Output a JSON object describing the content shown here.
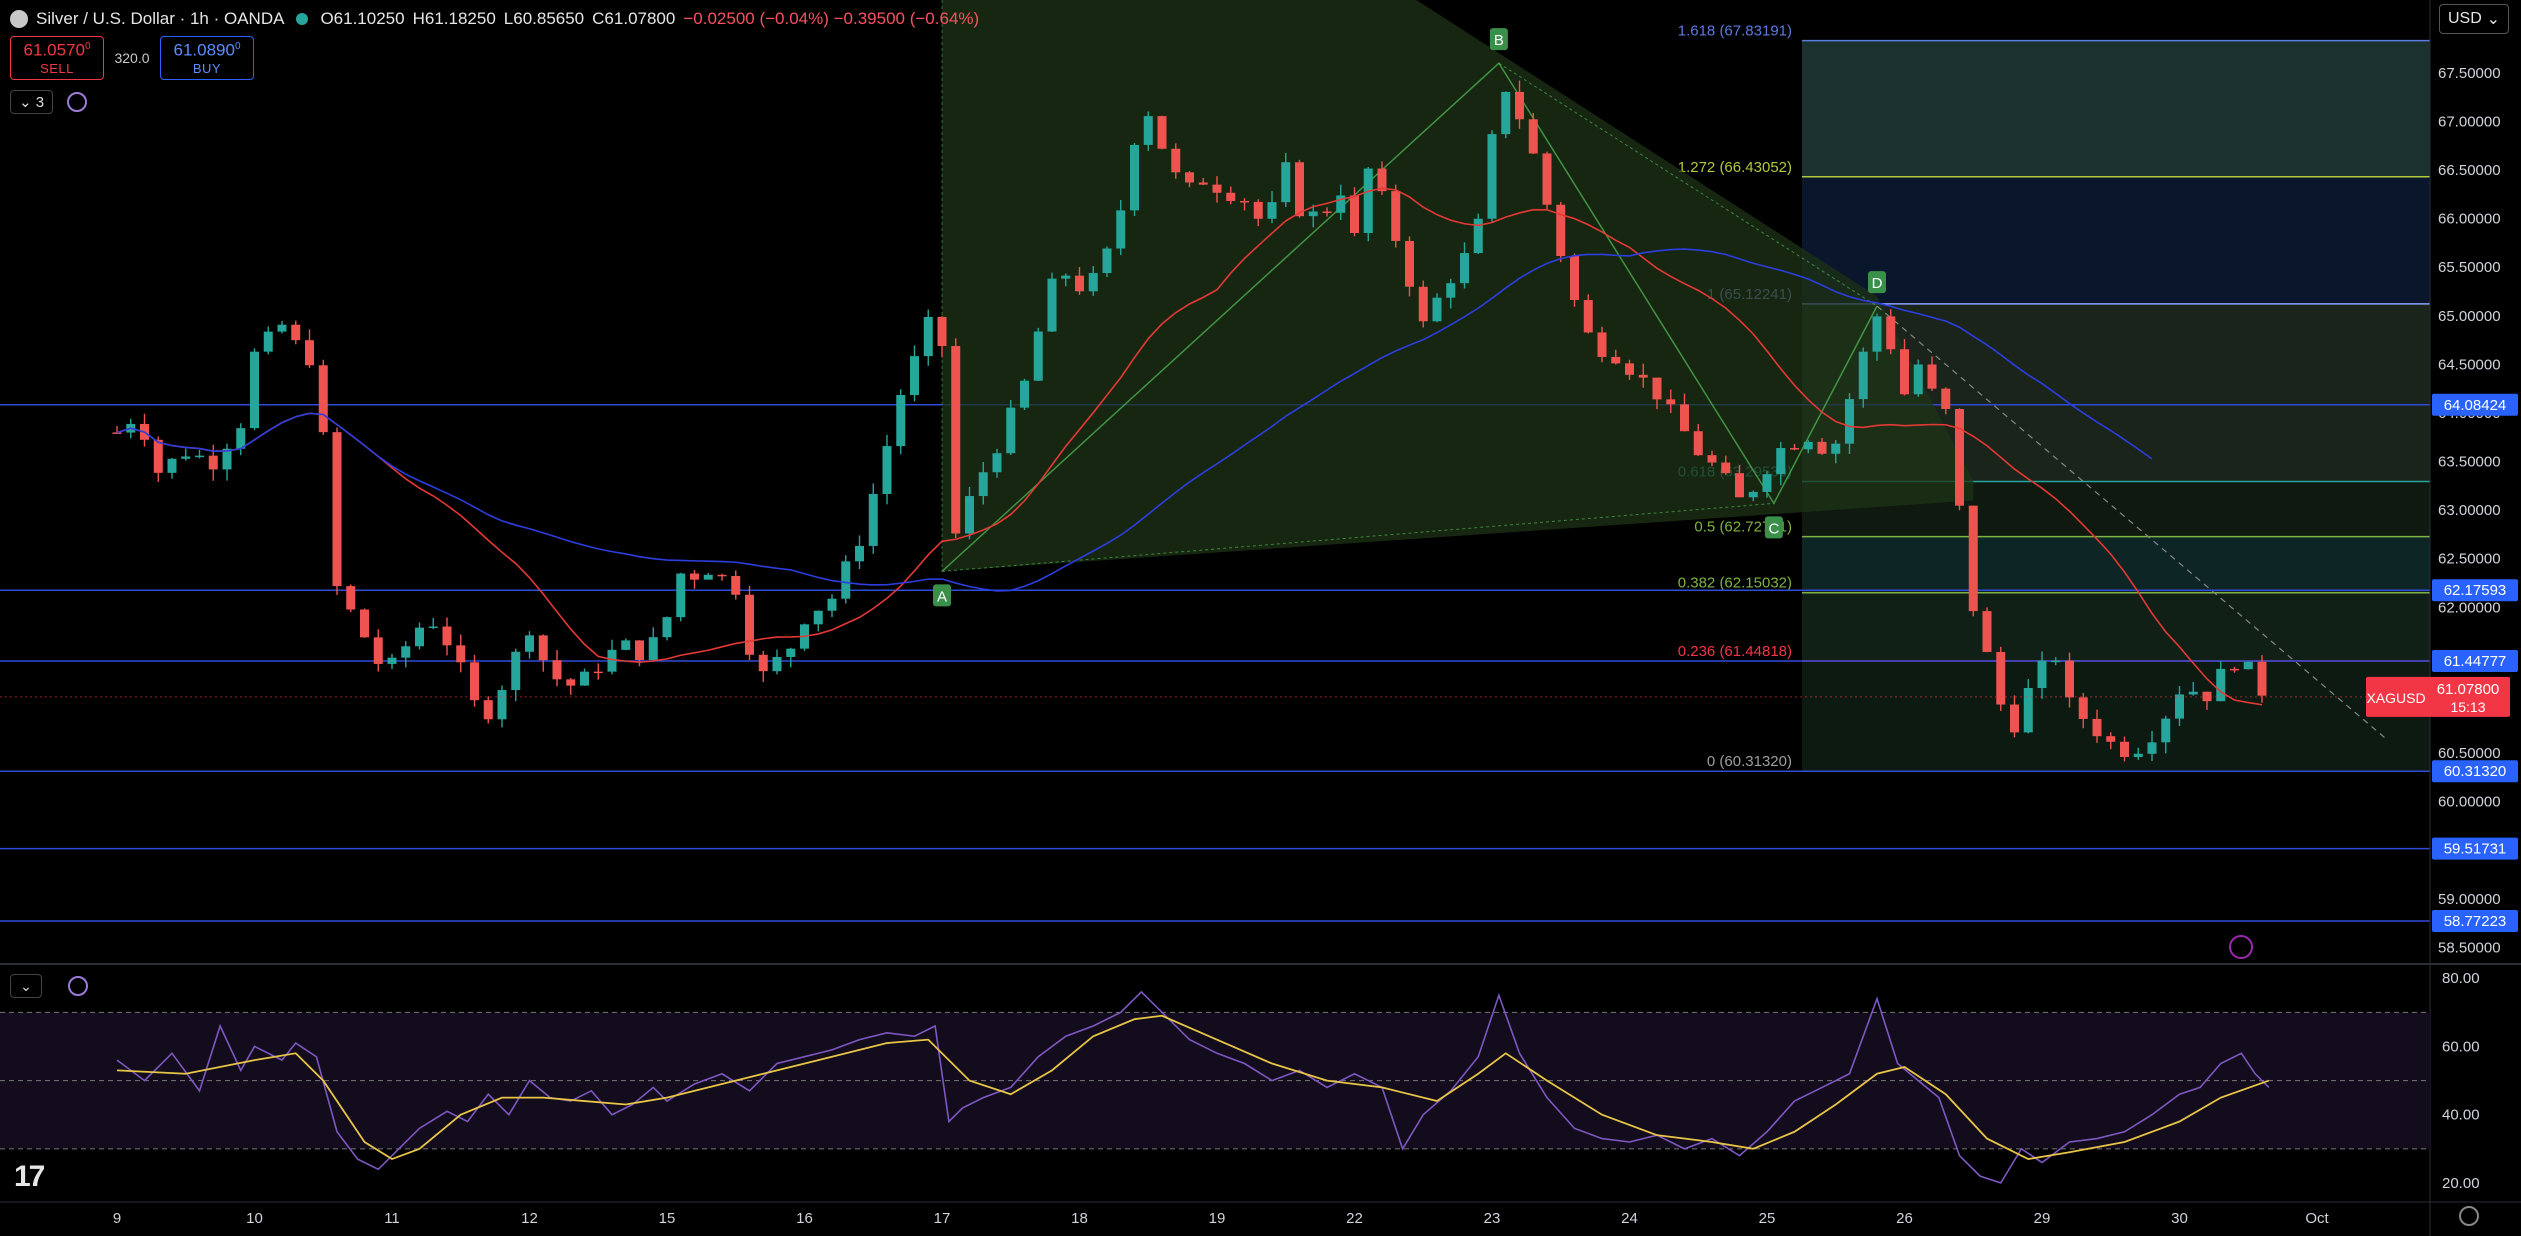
{
  "header": {
    "symbol": "Silver / U.S. Dollar · 1h · OANDA",
    "open": "O61.10250",
    "high": "H61.18250",
    "low": "L60.85650",
    "close": "C61.07800",
    "change": "−0.02500 (−0.04%)  −0.39500 (−0.64%)"
  },
  "trade": {
    "sell_price": "61.0570",
    "sell_sup": "0",
    "sell_label": "SELL",
    "spread": "320.0",
    "buy_price": "61.0890",
    "buy_sup": "0",
    "buy_label": "BUY"
  },
  "indicators_toggle": {
    "count": "3"
  },
  "currency": "USD",
  "colors": {
    "up": "#26a69a",
    "down": "#ef5350",
    "ma_fast": "#e53935",
    "ma_slow": "#2c3ee0",
    "rsi_line": "#7e57c2",
    "rsi_ma": "#e8c547",
    "hline": "#2f4bd8",
    "pattern_fill": "#1d3317"
  },
  "chart_data": {
    "type": "candlestick",
    "symbol": "XAGUSD",
    "y_ticks": [
      "67.50000",
      "67.00000",
      "66.50000",
      "66.00000",
      "65.50000",
      "65.00000",
      "64.50000",
      "64.00000",
      "63.50000",
      "63.00000",
      "62.50000",
      "62.00000",
      "61.50000",
      "61.00000",
      "60.50000",
      "60.00000",
      "59.50000",
      "59.00000",
      "58.50000"
    ],
    "ylim": [
      58.35,
      68.25
    ],
    "x_labels": [
      "9",
      "10",
      "11",
      "12",
      "15",
      "16",
      "17",
      "18",
      "19",
      "22",
      "23",
      "24",
      "25",
      "26",
      "29",
      "30",
      "Oct"
    ],
    "x_label_index": [
      0,
      1,
      2,
      3,
      4,
      5,
      6,
      7,
      8,
      9,
      10,
      11,
      12,
      13,
      14,
      15,
      16
    ],
    "price_levels": [
      {
        "value": 64.08424,
        "label": "64.08424",
        "color": "#2962ff"
      },
      {
        "value": 62.17593,
        "label": "62.17593",
        "color": "#2962ff"
      },
      {
        "value": 61.44777,
        "label": "61.44777",
        "color": "#2962ff"
      },
      {
        "value": 60.3132,
        "label": "60.31320",
        "color": "#2962ff"
      },
      {
        "value": 59.51731,
        "label": "59.51731",
        "color": "#2962ff"
      },
      {
        "value": 58.77223,
        "label": "58.77223",
        "color": "#2962ff"
      }
    ],
    "last_price": {
      "label": "XAGUSD",
      "value": 61.078,
      "value_label": "61.07800",
      "countdown": "15:13",
      "color": "#f23645"
    },
    "fibonacci": [
      {
        "ratio": "1.618",
        "value": 67.83191,
        "label": "1.618 (67.83191)",
        "color": "#5c7be0"
      },
      {
        "ratio": "1.272",
        "value": 66.43052,
        "label": "1.272 (66.43052)",
        "color": "#b2c93a"
      },
      {
        "ratio": "1",
        "value": 65.12241,
        "label": "1 (65.12241)",
        "color": "#8aa0ff"
      },
      {
        "ratio": "0.618",
        "value": 63.2953,
        "label": "0.618 (63.29530)",
        "color": "#26a69a"
      },
      {
        "ratio": "0.5",
        "value": 62.72781,
        "label": "0.5 (62.72781)",
        "color": "#7fb341"
      },
      {
        "ratio": "0.382",
        "value": 62.15032,
        "label": "0.382 (62.15032)",
        "color": "#7fb341"
      },
      {
        "ratio": "0.236",
        "value": 61.44818,
        "label": "0.236 (61.44818)",
        "color": "#f23645"
      },
      {
        "ratio": "0",
        "value": 60.3132,
        "label": "0 (60.31320)",
        "color": "#9e9e9e"
      }
    ],
    "pattern_points": [
      {
        "label": "A",
        "day": 6.0,
        "value": 62.37
      },
      {
        "label": "B",
        "day": 10.05,
        "value": 67.6
      },
      {
        "label": "C",
        "day": 12.05,
        "value": 63.07
      },
      {
        "label": "D",
        "day": 12.8,
        "value": 65.1
      }
    ],
    "price_path": [
      [
        0.0,
        63.8
      ],
      [
        0.15,
        64.0
      ],
      [
        0.3,
        63.4
      ],
      [
        0.5,
        63.6
      ],
      [
        0.7,
        63.5
      ],
      [
        0.9,
        63.9
      ],
      [
        1.0,
        64.6
      ],
      [
        1.2,
        64.9
      ],
      [
        1.3,
        64.7
      ],
      [
        1.45,
        64.5
      ],
      [
        1.6,
        62.2
      ],
      [
        1.8,
        61.7
      ],
      [
        1.95,
        61.3
      ],
      [
        2.05,
        61.5
      ],
      [
        2.25,
        61.9
      ],
      [
        2.35,
        61.8
      ],
      [
        2.45,
        61.5
      ],
      [
        2.55,
        61.2
      ],
      [
        2.65,
        60.8
      ],
      [
        2.8,
        61.2
      ],
      [
        2.9,
        61.5
      ],
      [
        3.0,
        61.8
      ],
      [
        3.15,
        61.3
      ],
      [
        3.3,
        61.2
      ],
      [
        3.45,
        61.3
      ],
      [
        3.55,
        61.5
      ],
      [
        3.7,
        61.6
      ],
      [
        3.85,
        61.5
      ],
      [
        4.0,
        61.9
      ],
      [
        4.05,
        62.4
      ],
      [
        4.15,
        62.3
      ],
      [
        4.3,
        62.4
      ],
      [
        4.5,
        62.2
      ],
      [
        4.6,
        61.6
      ],
      [
        4.7,
        61.3
      ],
      [
        4.9,
        61.6
      ],
      [
        5.0,
        61.9
      ],
      [
        5.2,
        62.1
      ],
      [
        5.4,
        62.7
      ],
      [
        5.55,
        63.4
      ],
      [
        5.7,
        64.2
      ],
      [
        5.85,
        64.7
      ],
      [
        5.95,
        65.1
      ],
      [
        6.0,
        64.7
      ],
      [
        6.05,
        63.0
      ],
      [
        6.1,
        62.75
      ],
      [
        6.2,
        63.1
      ],
      [
        6.3,
        63.4
      ],
      [
        6.45,
        63.8
      ],
      [
        6.6,
        64.3
      ],
      [
        6.75,
        65.1
      ],
      [
        6.85,
        65.5
      ],
      [
        7.0,
        65.3
      ],
      [
        7.15,
        65.4
      ],
      [
        7.3,
        66.1
      ],
      [
        7.45,
        67.2
      ],
      [
        7.55,
        67.0
      ],
      [
        7.65,
        66.5
      ],
      [
        7.8,
        66.3
      ],
      [
        7.9,
        66.4
      ],
      [
        8.05,
        66.3
      ],
      [
        8.2,
        66.2
      ],
      [
        8.35,
        65.9
      ],
      [
        8.5,
        66.5
      ],
      [
        8.6,
        66.1
      ],
      [
        8.75,
        66.0
      ],
      [
        8.9,
        66.3
      ],
      [
        9.0,
        65.8
      ],
      [
        9.1,
        66.5
      ],
      [
        9.2,
        66.2
      ],
      [
        9.35,
        65.6
      ],
      [
        9.5,
        64.9
      ],
      [
        9.65,
        65.3
      ],
      [
        9.8,
        65.6
      ],
      [
        9.95,
        66.1
      ],
      [
        10.05,
        67.5
      ],
      [
        10.15,
        67.2
      ],
      [
        10.25,
        66.9
      ],
      [
        10.35,
        66.4
      ],
      [
        10.45,
        65.9
      ],
      [
        10.55,
        65.4
      ],
      [
        10.65,
        64.9
      ],
      [
        10.75,
        64.7
      ],
      [
        10.9,
        64.6
      ],
      [
        11.05,
        64.4
      ],
      [
        11.2,
        64.2
      ],
      [
        11.35,
        63.9
      ],
      [
        11.5,
        63.6
      ],
      [
        11.65,
        63.4
      ],
      [
        11.8,
        63.1
      ],
      [
        11.95,
        63.3
      ],
      [
        12.05,
        63.6
      ],
      [
        12.2,
        63.7
      ],
      [
        12.35,
        63.8
      ],
      [
        12.45,
        63.5
      ],
      [
        12.55,
        63.9
      ],
      [
        12.65,
        64.4
      ],
      [
        12.8,
        65.0
      ],
      [
        12.9,
        64.7
      ],
      [
        13.0,
        64.2
      ],
      [
        13.1,
        64.5
      ],
      [
        13.2,
        64.2
      ],
      [
        13.3,
        64.0
      ],
      [
        13.4,
        63.0
      ],
      [
        13.5,
        62.0
      ],
      [
        13.6,
        61.5
      ],
      [
        13.7,
        61.0
      ],
      [
        13.8,
        60.8
      ],
      [
        13.95,
        61.3
      ],
      [
        14.1,
        61.5
      ],
      [
        14.2,
        61.0
      ],
      [
        14.35,
        60.8
      ],
      [
        14.5,
        60.6
      ],
      [
        14.65,
        60.5
      ],
      [
        14.8,
        60.7
      ],
      [
        14.95,
        61.0
      ],
      [
        15.05,
        61.3
      ],
      [
        15.15,
        61.0
      ],
      [
        15.25,
        61.2
      ],
      [
        15.35,
        61.4
      ],
      [
        15.45,
        61.5
      ],
      [
        15.55,
        61.2
      ],
      [
        15.65,
        61.08
      ]
    ],
    "rsi": {
      "y_ticks": [
        "80.00",
        "60.00",
        "40.00",
        "20.00"
      ],
      "ylim": [
        15,
        83
      ],
      "levels": [
        70,
        50,
        30
      ],
      "path": [
        [
          0.0,
          56
        ],
        [
          0.2,
          50
        ],
        [
          0.4,
          58
        ],
        [
          0.6,
          47
        ],
        [
          0.75,
          66
        ],
        [
          0.9,
          53
        ],
        [
          1.0,
          60
        ],
        [
          1.2,
          56
        ],
        [
          1.3,
          61
        ],
        [
          1.45,
          57
        ],
        [
          1.6,
          35
        ],
        [
          1.75,
          27
        ],
        [
          1.9,
          24
        ],
        [
          2.05,
          30
        ],
        [
          2.2,
          36
        ],
        [
          2.4,
          41
        ],
        [
          2.55,
          38
        ],
        [
          2.7,
          46
        ],
        [
          2.85,
          40
        ],
        [
          3.0,
          50
        ],
        [
          3.15,
          45
        ],
        [
          3.3,
          44
        ],
        [
          3.45,
          47
        ],
        [
          3.6,
          40
        ],
        [
          3.75,
          43
        ],
        [
          3.9,
          48
        ],
        [
          4.0,
          44
        ],
        [
          4.2,
          49
        ],
        [
          4.4,
          52
        ],
        [
          4.6,
          47
        ],
        [
          4.8,
          55
        ],
        [
          5.0,
          57
        ],
        [
          5.2,
          59
        ],
        [
          5.4,
          62
        ],
        [
          5.6,
          64
        ],
        [
          5.8,
          63
        ],
        [
          5.95,
          66
        ],
        [
          6.05,
          38
        ],
        [
          6.15,
          42
        ],
        [
          6.3,
          45
        ],
        [
          6.5,
          48
        ],
        [
          6.7,
          57
        ],
        [
          6.9,
          63
        ],
        [
          7.1,
          66
        ],
        [
          7.3,
          70
        ],
        [
          7.45,
          76
        ],
        [
          7.6,
          70
        ],
        [
          7.8,
          62
        ],
        [
          8.0,
          58
        ],
        [
          8.2,
          55
        ],
        [
          8.4,
          50
        ],
        [
          8.6,
          53
        ],
        [
          8.8,
          48
        ],
        [
          9.0,
          52
        ],
        [
          9.2,
          48
        ],
        [
          9.35,
          30
        ],
        [
          9.5,
          40
        ],
        [
          9.7,
          47
        ],
        [
          9.9,
          57
        ],
        [
          10.05,
          75
        ],
        [
          10.2,
          58
        ],
        [
          10.4,
          45
        ],
        [
          10.6,
          36
        ],
        [
          10.8,
          33
        ],
        [
          11.0,
          32
        ],
        [
          11.2,
          34
        ],
        [
          11.4,
          30
        ],
        [
          11.6,
          33
        ],
        [
          11.8,
          28
        ],
        [
          12.0,
          35
        ],
        [
          12.2,
          44
        ],
        [
          12.4,
          48
        ],
        [
          12.6,
          52
        ],
        [
          12.8,
          74
        ],
        [
          12.95,
          55
        ],
        [
          13.1,
          50
        ],
        [
          13.25,
          45
        ],
        [
          13.4,
          28
        ],
        [
          13.55,
          22
        ],
        [
          13.7,
          20
        ],
        [
          13.85,
          30
        ],
        [
          14.0,
          26
        ],
        [
          14.2,
          32
        ],
        [
          14.4,
          33
        ],
        [
          14.6,
          35
        ],
        [
          14.8,
          40
        ],
        [
          15.0,
          46
        ],
        [
          15.15,
          48
        ],
        [
          15.3,
          55
        ],
        [
          15.45,
          58
        ],
        [
          15.55,
          52
        ],
        [
          15.65,
          48
        ]
      ],
      "ma_path": [
        [
          0.0,
          53
        ],
        [
          0.5,
          52
        ],
        [
          1.0,
          56
        ],
        [
          1.3,
          58
        ],
        [
          1.5,
          50
        ],
        [
          1.8,
          32
        ],
        [
          2.0,
          27
        ],
        [
          2.2,
          30
        ],
        [
          2.5,
          40
        ],
        [
          2.8,
          45
        ],
        [
          3.1,
          45
        ],
        [
          3.4,
          44
        ],
        [
          3.7,
          43
        ],
        [
          4.0,
          45
        ],
        [
          4.4,
          49
        ],
        [
          4.8,
          53
        ],
        [
          5.2,
          57
        ],
        [
          5.6,
          61
        ],
        [
          5.9,
          62
        ],
        [
          6.2,
          50
        ],
        [
          6.5,
          46
        ],
        [
          6.8,
          53
        ],
        [
          7.1,
          63
        ],
        [
          7.4,
          68
        ],
        [
          7.6,
          69
        ],
        [
          8.0,
          62
        ],
        [
          8.4,
          55
        ],
        [
          8.8,
          50
        ],
        [
          9.2,
          48
        ],
        [
          9.6,
          44
        ],
        [
          9.9,
          52
        ],
        [
          10.1,
          58
        ],
        [
          10.4,
          50
        ],
        [
          10.8,
          40
        ],
        [
          11.2,
          34
        ],
        [
          11.6,
          32
        ],
        [
          11.9,
          30
        ],
        [
          12.2,
          35
        ],
        [
          12.5,
          43
        ],
        [
          12.8,
          52
        ],
        [
          13.0,
          54
        ],
        [
          13.3,
          46
        ],
        [
          13.6,
          33
        ],
        [
          13.9,
          27
        ],
        [
          14.2,
          29
        ],
        [
          14.6,
          32
        ],
        [
          15.0,
          38
        ],
        [
          15.3,
          45
        ],
        [
          15.65,
          50
        ]
      ]
    }
  }
}
